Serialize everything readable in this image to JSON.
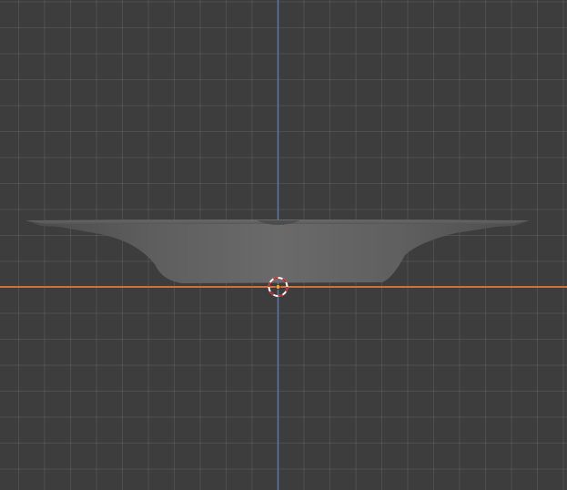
{
  "viewport": {
    "view": "front-orthographic",
    "object": "plate-mesh",
    "colors": {
      "background": "#3d3d3d",
      "grid": "#4f4f4f",
      "x_axis": "#d0703a",
      "z_axis": "#3f7fcf",
      "cursor_red": "#c8282b",
      "origin": "#f0a030"
    },
    "icons": [
      "3d-cursor-icon",
      "origin-point-icon"
    ]
  }
}
